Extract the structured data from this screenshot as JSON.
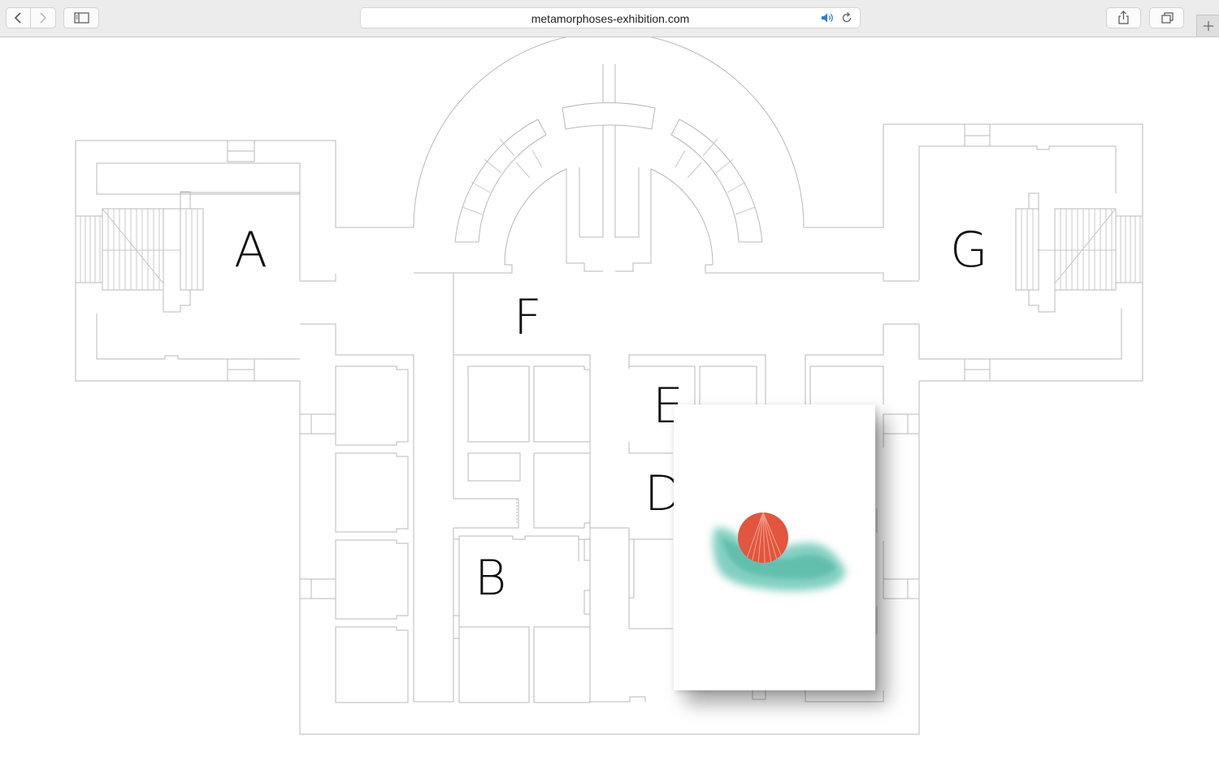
{
  "browser": {
    "url": "metamorphoses-exhibition.com",
    "icons": {
      "back": "chevron-left-icon",
      "forward": "chevron-right-icon",
      "sidebar": "sidebar-icon",
      "audio": "speaker-icon",
      "reload": "reload-icon",
      "share": "share-icon",
      "tabs": "tabs-icon",
      "new_tab": "plus-icon"
    },
    "accent": "#2a7de1"
  },
  "floorplan": {
    "rooms": [
      {
        "id": "a",
        "label": "A"
      },
      {
        "id": "b",
        "label": "B"
      },
      {
        "id": "d",
        "label": "D"
      },
      {
        "id": "e",
        "label": "E"
      },
      {
        "id": "f",
        "label": "F"
      },
      {
        "id": "g",
        "label": "G"
      }
    ],
    "line_color": "#b5b5b5"
  },
  "artwork": {
    "colors": {
      "sun": "#e2553f",
      "wave": "#58bfad"
    }
  }
}
